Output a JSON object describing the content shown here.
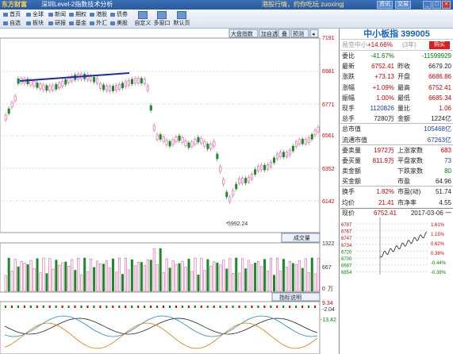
{
  "titlebar": {
    "logo": "东方财富",
    "title": "深圳Level-2指数技术分析",
    "right_text": "港股行情，约你吃玩  zuoxingj",
    "btn1": "资讯",
    "btn2": "交易",
    "win_min": "_",
    "win_max": "□",
    "win_close": "×"
  },
  "toolbar": {
    "buttons": [
      "首页",
      "全球",
      "新闻",
      "期权",
      "港股",
      "债券",
      "自选",
      "板块",
      "研报",
      "基金",
      "外汇",
      "美股"
    ],
    "big_buttons": [
      "自定义",
      "多窗口",
      "默认页"
    ]
  },
  "chart": {
    "tabs": [
      "大盘指数",
      "加自选",
      "叠",
      "预测"
    ],
    "price_labels": [
      "7191",
      "6981",
      "6771",
      "6561",
      "6352",
      "6142"
    ],
    "low_marker": "5992.24",
    "vol_button": "成交量",
    "vol_labels": [
      "1322",
      "667",
      "0"
    ],
    "vol_unit": "万",
    "ind_button": "指标说明",
    "ind_labels": [
      "9.34",
      "-2.04",
      "-13.42"
    ]
  },
  "panel": {
    "title": "中小板指  399005",
    "sub_name": "易签中小",
    "sub_change": "+14.66%",
    "sub_bracket": "(3年)",
    "buy_label": "购买",
    "rows": [
      {
        "l1": "委比",
        "v1": "-41.67%",
        "c1": "green",
        "l2": "",
        "v2": "-11599929",
        "c2": "green"
      },
      {
        "l1": "最新",
        "v1": "6752.41",
        "c1": "red",
        "l2": "昨收",
        "v2": "6679.20",
        "c2": "dark"
      },
      {
        "l1": "涨跌",
        "v1": "+73.13",
        "c1": "red",
        "l2": "开盘",
        "v2": "6686.86",
        "c2": "red"
      },
      {
        "l1": "涨幅",
        "v1": "+1.09%",
        "c1": "red",
        "l2": "最高",
        "v2": "6752.41",
        "c2": "red"
      },
      {
        "l1": "振幅",
        "v1": "1.00%",
        "c1": "red",
        "l2": "最低",
        "v2": "6685.34",
        "c2": "red"
      },
      {
        "l1": "现手",
        "v1": "1120826",
        "c1": "blue",
        "l2": "量比",
        "v2": "1.06",
        "c2": "red"
      },
      {
        "l1": "总手",
        "v1": "7280万",
        "c1": "dark",
        "l2": "金额",
        "v2": "1224亿",
        "c2": "dark"
      },
      {
        "l1": "总市值",
        "v1": "",
        "c1": "dark",
        "l2": "",
        "v2": "105468亿",
        "c2": "blue"
      },
      {
        "l1": "流通市值",
        "v1": "",
        "c1": "dark",
        "l2": "",
        "v2": "67263亿",
        "c2": "blue"
      },
      {
        "l1": "委卖量",
        "v1": "1972万",
        "c1": "red",
        "l2": "上涨家数",
        "v2": "683",
        "c2": "red"
      },
      {
        "l1": "委买量",
        "v1": "811.9万",
        "c1": "red",
        "l2": "平盘家数",
        "v2": "73",
        "c2": "blue"
      },
      {
        "l1": "卖金额",
        "v1": "",
        "c1": "dark",
        "l2": "下跌家数",
        "v2": "80",
        "c2": "green"
      },
      {
        "l1": "买金额",
        "v1": "",
        "c1": "dark",
        "l2": "市盈",
        "v2": "64.96",
        "c2": "dark"
      },
      {
        "l1": "换手",
        "v1": "1.82%",
        "c1": "red",
        "l2": "市盈(动)",
        "v2": "51.74",
        "c2": "dark"
      },
      {
        "l1": "均价",
        "v1": "21.41",
        "c1": "red",
        "l2": "市净率",
        "v2": "4.55",
        "c2": "dark"
      }
    ],
    "mini": {
      "label": "现价",
      "price": "6752.41",
      "date": "2017-03-06 一",
      "left_ticks": [
        "6787",
        "6767",
        "6747",
        "6734",
        "6720",
        "6700",
        "6687",
        "6654"
      ],
      "right_ticks": [
        "1.61%",
        "1.15%",
        "0.62%",
        "0.38%",
        "-0.44%",
        "-0.38%"
      ]
    }
  },
  "colors": {
    "up": "#d00000",
    "down": "#008000",
    "accent": "#1565c0"
  }
}
